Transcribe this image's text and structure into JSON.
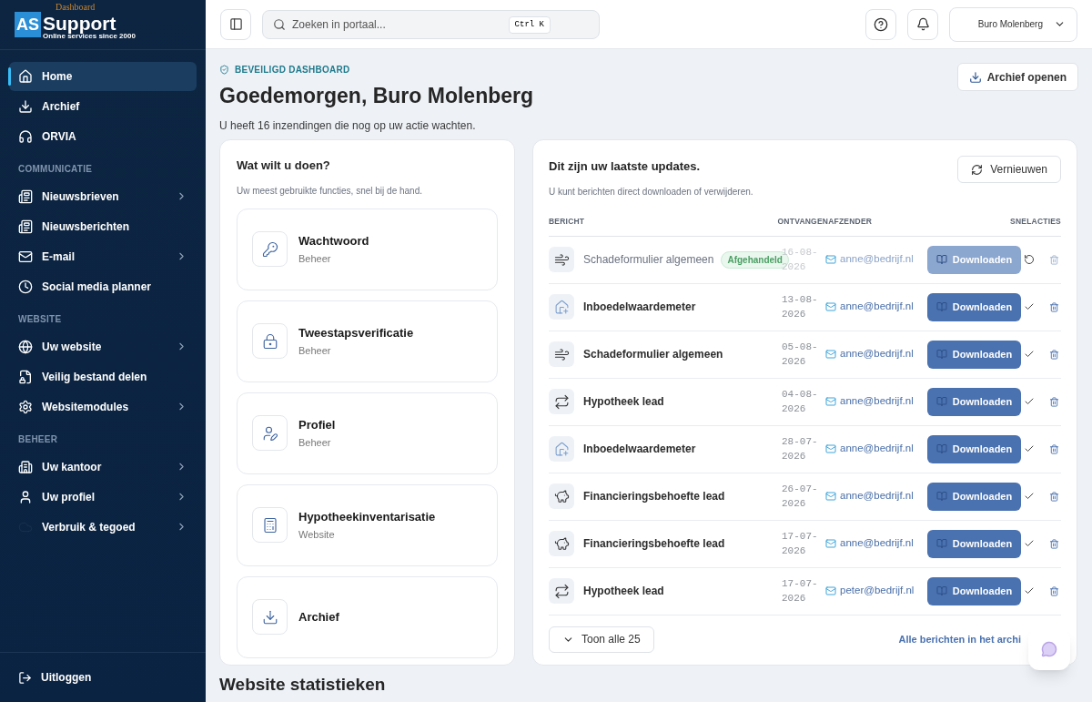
{
  "brand": {
    "top": "Dashboard",
    "mark": "AS",
    "name": "Support",
    "tagline": "Online services since 2000"
  },
  "sidebar": {
    "items": [
      {
        "label": "Home",
        "selected": true,
        "submenu": false
      },
      {
        "label": "Archief",
        "selected": false,
        "submenu": false
      },
      {
        "label": "ORVIA",
        "selected": false,
        "submenu": false
      },
      {
        "kind": "section",
        "label": "COMMUNICATIE"
      },
      {
        "label": "Nieuwsbrieven",
        "selected": false,
        "submenu": true
      },
      {
        "label": "Nieuwsberichten",
        "selected": false,
        "submenu": false
      },
      {
        "label": "E-mail",
        "selected": false,
        "submenu": true
      },
      {
        "label": "Social media planner",
        "selected": false,
        "submenu": false
      },
      {
        "kind": "section",
        "label": "WEBSITE"
      },
      {
        "label": "Uw website",
        "selected": false,
        "submenu": true
      },
      {
        "label": "Veilig bestand delen",
        "selected": false,
        "submenu": false
      },
      {
        "label": "Websitemodules",
        "selected": false,
        "submenu": true
      },
      {
        "kind": "section",
        "label": "BEHEER"
      },
      {
        "label": "Uw kantoor",
        "selected": false,
        "submenu": true
      },
      {
        "label": "Uw profiel",
        "selected": false,
        "submenu": true
      },
      {
        "label": "Verbruik & tegoed",
        "selected": false,
        "submenu": true
      }
    ],
    "logout": "Uitloggen"
  },
  "topbar": {
    "search_placeholder": "Zoeken in portaal...",
    "shortcut": "Ctrl K",
    "account": "Buro Molenberg"
  },
  "header": {
    "eyebrow": "BEVEILIGD DASHBOARD",
    "title": "Goedemorgen, Buro Molenberg",
    "subtitle": "U heeft 16 inzendingen die nog op uw actie wachten.",
    "action": "Archief openen"
  },
  "quick_actions": {
    "title": "Wat wilt u doen?",
    "subtitle": "Uw meest gebruikte functies, snel bij de hand.",
    "items": [
      {
        "title": "Wachtwoord",
        "caption": "Beheer"
      },
      {
        "title": "Tweestapsverificatie",
        "caption": "Beheer"
      },
      {
        "title": "Profiel",
        "caption": "Beheer"
      },
      {
        "title": "Hypotheekinventarisatie",
        "caption": "Website"
      },
      {
        "title": "Archief"
      }
    ]
  },
  "updates": {
    "title": "Dit zijn uw laatste updates.",
    "subtitle": "U kunt berichten direct downloaden of verwijderen.",
    "refresh": "Vernieuwen",
    "columns": [
      "BERICHT",
      "ONTVANGEN",
      "AFZENDER",
      "SNELACTIES"
    ],
    "rows": [
      {
        "title": "Schadeformulier algemeen",
        "badge": "Afgehandeld",
        "handled": true,
        "date": "16-08-2026",
        "sender": "anne@bedrijf.nl",
        "action": "Downloaden"
      },
      {
        "title": "Inboedelwaardemeter",
        "handled": false,
        "date": "13-08-2026",
        "sender": "anne@bedrijf.nl",
        "action": "Downloaden"
      },
      {
        "title": "Schadeformulier algemeen",
        "handled": false,
        "date": "05-08-2026",
        "sender": "anne@bedrijf.nl",
        "action": "Downloaden"
      },
      {
        "title": "Hypotheek lead",
        "handled": false,
        "date": "04-08-2026",
        "sender": "anne@bedrijf.nl",
        "action": "Downloaden"
      },
      {
        "title": "Inboedelwaardemeter",
        "handled": false,
        "date": "28-07-2026",
        "sender": "anne@bedrijf.nl",
        "action": "Downloaden"
      },
      {
        "title": "Financieringsbehoefte lead",
        "handled": false,
        "date": "26-07-2026",
        "sender": "anne@bedrijf.nl",
        "action": "Downloaden"
      },
      {
        "title": "Financieringsbehoefte lead",
        "handled": false,
        "date": "17-07-2026",
        "sender": "anne@bedrijf.nl",
        "action": "Downloaden"
      },
      {
        "title": "Hypotheek lead",
        "handled": false,
        "date": "17-07-2026",
        "sender": "peter@bedrijf.nl",
        "action": "Downloaden"
      }
    ],
    "show_all": "Toon alle 25",
    "archive_link": "Alle berichten in het archi"
  },
  "statistics": {
    "title": "Website statistieken"
  }
}
